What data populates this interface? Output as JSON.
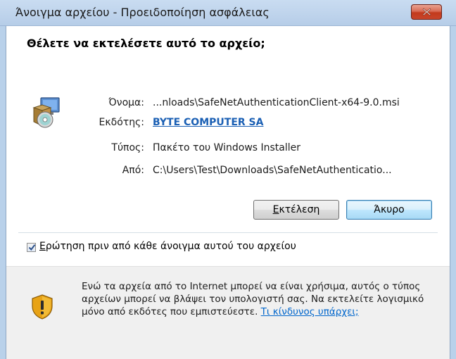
{
  "window": {
    "title": "Άνοιγμα αρχείου - Προειδοποίηση ασφάλειας"
  },
  "question": "Θέλετε να εκτελέσετε αυτό το αρχείο;",
  "file_info": {
    "name_label": "Όνομα:",
    "name_value": "...nloads\\SafeNetAuthenticationClient-x64-9.0.msi",
    "publisher_label": "Εκδότης:",
    "publisher_value": "BYTE COMPUTER SA",
    "type_label": "Τύπος:",
    "type_value": "Πακέτο του Windows Installer",
    "from_label": "Από:",
    "from_value": "C:\\Users\\Test\\Downloads\\SafeNetAuthenticatio..."
  },
  "buttons": {
    "run_first": "Ε",
    "run_rest": "κτέλεση",
    "cancel": "Άκυρο"
  },
  "checkbox": {
    "checked": true,
    "label_first": "Ε",
    "label_rest": "ρώτηση πριν από κάθε άνοιγμα αυτού του αρχείου"
  },
  "warning": {
    "text": "Ενώ τα αρχεία από το Internet μπορεί να είναι χρήσιμα, αυτός ο τύπος αρχείων μπορεί να βλάψει τον υπολογιστή σας. Να εκτελείτε λογισμικό μόνο από εκδότες που εμπιστεύεστε.",
    "link": "Τι κίνδυνος υπάρχει;"
  },
  "icons": {
    "close": "close-icon",
    "package": "installer-package-icon",
    "shield": "security-warning-shield-icon",
    "check": "checkmark-icon"
  },
  "colors": {
    "link": "#1a5fb4",
    "close_button": "#c8452a",
    "warning_pane": "#f0f0f0"
  }
}
